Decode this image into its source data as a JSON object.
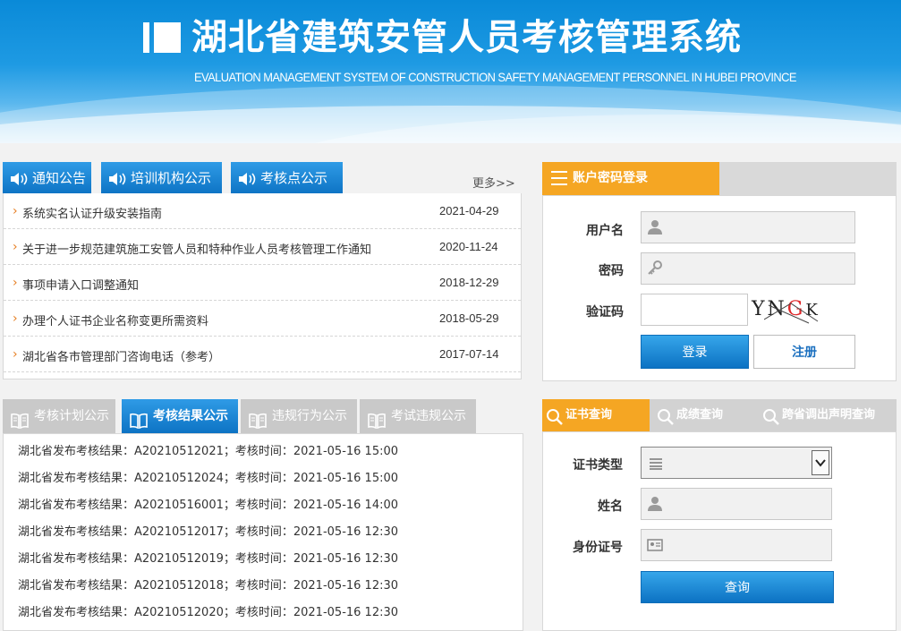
{
  "banner": {
    "title": "湖北省建筑安管人员考核管理系统",
    "subtitle": "EVALUATION MANAGEMENT SYSTEM OF CONSTRUCTION SAFETY MANAGEMENT PERSONNEL IN HUBEI PROVINCE"
  },
  "notice": {
    "tabs": [
      {
        "label": "通知公告",
        "icon": "speaker-icon"
      },
      {
        "label": "培训机构公示",
        "icon": "speaker-icon"
      },
      {
        "label": "考核点公示",
        "icon": "speaker-icon"
      }
    ],
    "more": "更多>>",
    "items": [
      {
        "title": "系统实名认证升级安装指南",
        "date": "2021-04-29"
      },
      {
        "title": "关于进一步规范建筑施工安管人员和特种作业人员考核管理工作通知",
        "date": "2020-11-24"
      },
      {
        "title": "事项申请入口调整通知",
        "date": "2018-12-29"
      },
      {
        "title": "办理个人证书企业名称变更所需资料",
        "date": "2018-05-29"
      },
      {
        "title": "湖北省各市管理部门咨询电话（参考）",
        "date": "2017-07-14"
      }
    ]
  },
  "login": {
    "tab_active": "账户密码登录",
    "username_label": "用户名",
    "password_label": "密码",
    "captcha_label": "验证码",
    "captcha_text": [
      "Y",
      "N",
      "G",
      "K"
    ],
    "login_button": "登录",
    "register_button": "注册"
  },
  "results": {
    "tabs": [
      {
        "label": "考核计划公示",
        "active": false
      },
      {
        "label": "考核结果公示",
        "active": true
      },
      {
        "label": "违规行为公示",
        "active": false
      },
      {
        "label": "考试违规公示",
        "active": false
      }
    ],
    "items": [
      "湖北省发布考核结果：A20210512021；考核时间：2021-05-16 15:00",
      "湖北省发布考核结果：A20210512024；考核时间：2021-05-16 15:00",
      "湖北省发布考核结果：A20210516001；考核时间：2021-05-16 14:00",
      "湖北省发布考核结果：A20210512017；考核时间：2021-05-16 12:30",
      "湖北省发布考核结果：A20210512019；考核时间：2021-05-16 12:30",
      "湖北省发布考核结果：A20210512018；考核时间：2021-05-16 12:30",
      "湖北省发布考核结果：A20210512020；考核时间：2021-05-16 12:30"
    ]
  },
  "query": {
    "tabs": [
      {
        "label": "证书查询",
        "active": true
      },
      {
        "label": "成绩查询",
        "active": false
      },
      {
        "label": "跨省调出声明查询",
        "active": false
      }
    ],
    "cert_type_label": "证书类型",
    "name_label": "姓名",
    "id_label": "身份证号",
    "query_button": "查询"
  },
  "colors": {
    "accent_blue": "#0d73c4",
    "accent_orange": "#f5a623",
    "tab_gray": "#c9c9c9"
  }
}
